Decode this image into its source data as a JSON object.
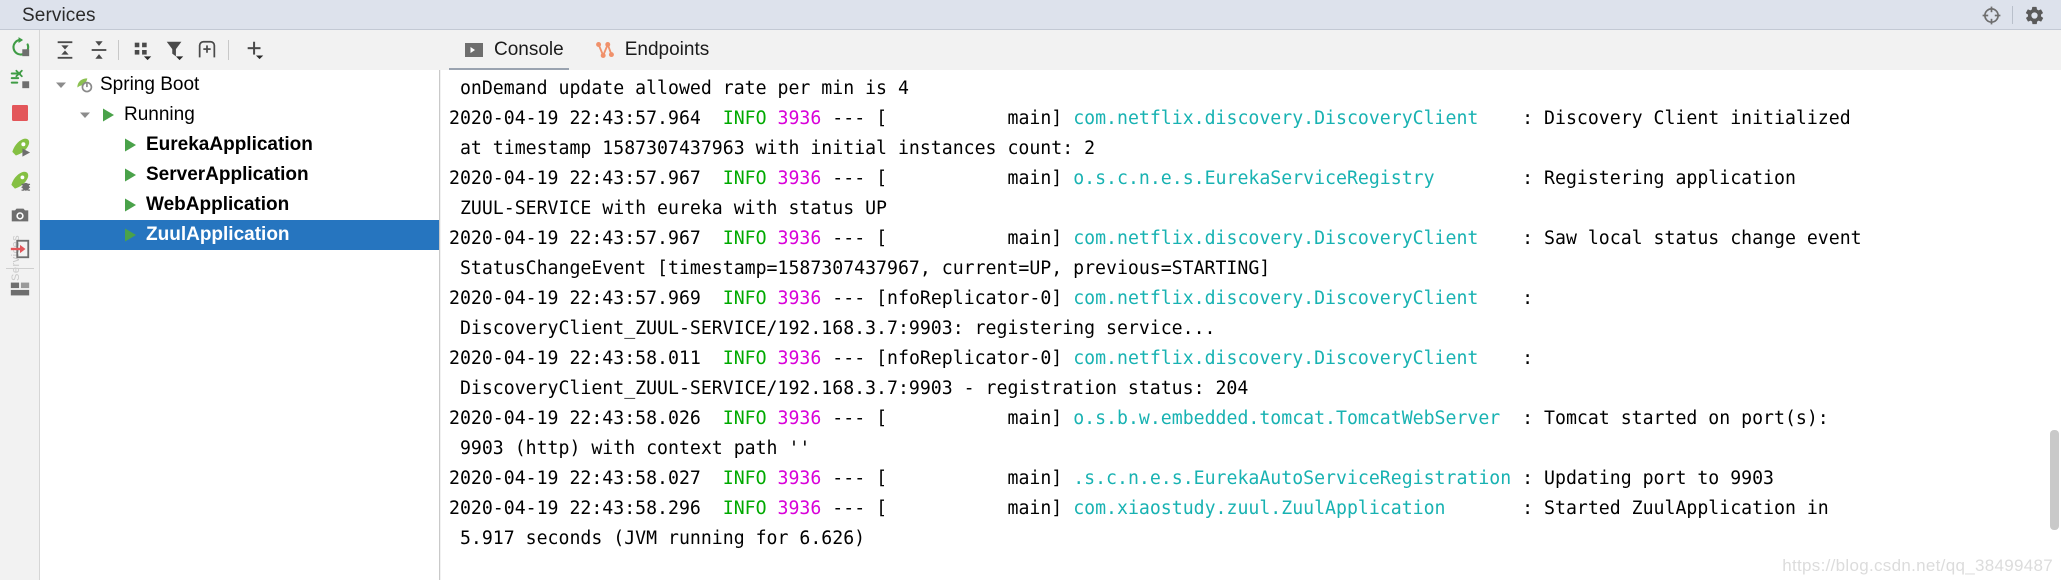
{
  "window": {
    "title": "Services",
    "actions": [
      {
        "name": "target-icon",
        "label": "Locate"
      },
      {
        "name": "gear-icon",
        "label": "Settings"
      }
    ]
  },
  "rail": {
    "watermark": "Services",
    "buttons": [
      {
        "name": "rerun-icon",
        "label": "Rerun"
      },
      {
        "name": "rerun-failed-icon",
        "label": "Rerun Failed Tests"
      },
      {
        "name": "stop-icon",
        "label": "Stop",
        "color": "#e3565a"
      },
      {
        "name": "run-icon",
        "label": "Run"
      },
      {
        "name": "debug-icon",
        "label": "Debug"
      },
      {
        "name": "camera-icon",
        "label": "Take Thread Dump"
      },
      {
        "name": "export-icon",
        "label": "Export Threads",
        "color": "#e3565a"
      },
      {
        "name": "layout-icon",
        "label": "Show Services Layout"
      }
    ]
  },
  "tree_toolbar": {
    "buttons": [
      {
        "name": "expand-all-icon",
        "label": "Expand All"
      },
      {
        "name": "collapse-all-icon",
        "label": "Collapse All"
      },
      {
        "name": "group-by-icon",
        "label": "Group By"
      },
      {
        "name": "filter-icon",
        "label": "Filter"
      },
      {
        "name": "add-configuration-icon",
        "label": "Add Configuration"
      },
      {
        "name": "add-icon",
        "label": "Add Service"
      }
    ]
  },
  "tree": {
    "rows": [
      {
        "depth": 0,
        "twisty": "down",
        "icon": "spring-boot-icon",
        "label": "Spring Boot",
        "bold": false,
        "selected": false
      },
      {
        "depth": 1,
        "twisty": "down",
        "icon": "run-triangle-icon",
        "label": "Running",
        "bold": false,
        "selected": false
      },
      {
        "depth": 2,
        "twisty": "none",
        "icon": "run-triangle-icon",
        "label": "EurekaApplication",
        "bold": true,
        "selected": false
      },
      {
        "depth": 2,
        "twisty": "none",
        "icon": "run-triangle-icon",
        "label": "ServerApplication",
        "bold": true,
        "selected": false
      },
      {
        "depth": 2,
        "twisty": "none",
        "icon": "run-triangle-icon",
        "label": "WebApplication",
        "bold": true,
        "selected": false
      },
      {
        "depth": 2,
        "twisty": "none",
        "icon": "run-triangle-icon",
        "label": "ZuulApplication",
        "bold": true,
        "selected": true
      }
    ],
    "selection_color": "#2675bf"
  },
  "content": {
    "tabs": [
      {
        "name": "tab-console",
        "label": "Console",
        "icon": "console-icon",
        "active": true
      },
      {
        "name": "tab-endpoints",
        "label": "Endpoints",
        "icon": "endpoints-icon",
        "active": false
      }
    ]
  },
  "console": {
    "colors": {
      "timestamp": "#000000",
      "level": "#00aa00",
      "pid": "#d900d9",
      "logger": "#18b2b2",
      "message": "#000000"
    },
    "lines": [
      {
        "type": "cont",
        "text": " onDemand update allowed rate per min is 4"
      },
      {
        "type": "log",
        "ts": "2020-04-19 22:43:57.964",
        "level": "INFO",
        "pid": "3936",
        "sep": " --- [",
        "thread": "           main]",
        "logger": " com.netflix.discovery.DiscoveryClient   ",
        "msg": " : Discovery Client initialized"
      },
      {
        "type": "cont",
        "text": " at timestamp 1587307437963 with initial instances count: 2"
      },
      {
        "type": "log",
        "ts": "2020-04-19 22:43:57.967",
        "level": "INFO",
        "pid": "3936",
        "sep": " --- [",
        "thread": "           main]",
        "logger": " o.s.c.n.e.s.EurekaServiceRegistry       ",
        "msg": " : Registering application"
      },
      {
        "type": "cont",
        "text": " ZUUL-SERVICE with eureka with status UP"
      },
      {
        "type": "log",
        "ts": "2020-04-19 22:43:57.967",
        "level": "INFO",
        "pid": "3936",
        "sep": " --- [",
        "thread": "           main]",
        "logger": " com.netflix.discovery.DiscoveryClient   ",
        "msg": " : Saw local status change event"
      },
      {
        "type": "cont",
        "text": " StatusChangeEvent [timestamp=1587307437967, current=UP, previous=STARTING]"
      },
      {
        "type": "log",
        "ts": "2020-04-19 22:43:57.969",
        "level": "INFO",
        "pid": "3936",
        "sep": " --- [",
        "thread": "nfoReplicator-0]",
        "logger": " com.netflix.discovery.DiscoveryClient   ",
        "msg": " :"
      },
      {
        "type": "cont",
        "text": " DiscoveryClient_ZUUL-SERVICE/192.168.3.7:9903: registering service..."
      },
      {
        "type": "log",
        "ts": "2020-04-19 22:43:58.011",
        "level": "INFO",
        "pid": "3936",
        "sep": " --- [",
        "thread": "nfoReplicator-0]",
        "logger": " com.netflix.discovery.DiscoveryClient   ",
        "msg": " :"
      },
      {
        "type": "cont",
        "text": " DiscoveryClient_ZUUL-SERVICE/192.168.3.7:9903 - registration status: 204"
      },
      {
        "type": "log",
        "ts": "2020-04-19 22:43:58.026",
        "level": "INFO",
        "pid": "3936",
        "sep": " --- [",
        "thread": "           main]",
        "logger": " o.s.b.w.embedded.tomcat.TomcatWebServer ",
        "msg": " : Tomcat started on port(s):"
      },
      {
        "type": "cont",
        "text": " 9903 (http) with context path ''"
      },
      {
        "type": "log",
        "ts": "2020-04-19 22:43:58.027",
        "level": "INFO",
        "pid": "3936",
        "sep": " --- [",
        "thread": "           main]",
        "logger": " .s.c.n.e.s.EurekaAutoServiceRegistration",
        "msg": " : Updating port to 9903"
      },
      {
        "type": "log",
        "ts": "2020-04-19 22:43:58.296",
        "level": "INFO",
        "pid": "3936",
        "sep": " --- [",
        "thread": "           main]",
        "logger": " com.xiaostudy.zuul.ZuulApplication      ",
        "msg": " : Started ZuulApplication in"
      },
      {
        "type": "cont",
        "text": " 5.917 seconds (JVM running for 6.626)"
      }
    ],
    "watermark": "https://blog.csdn.net/qq_38499487"
  }
}
